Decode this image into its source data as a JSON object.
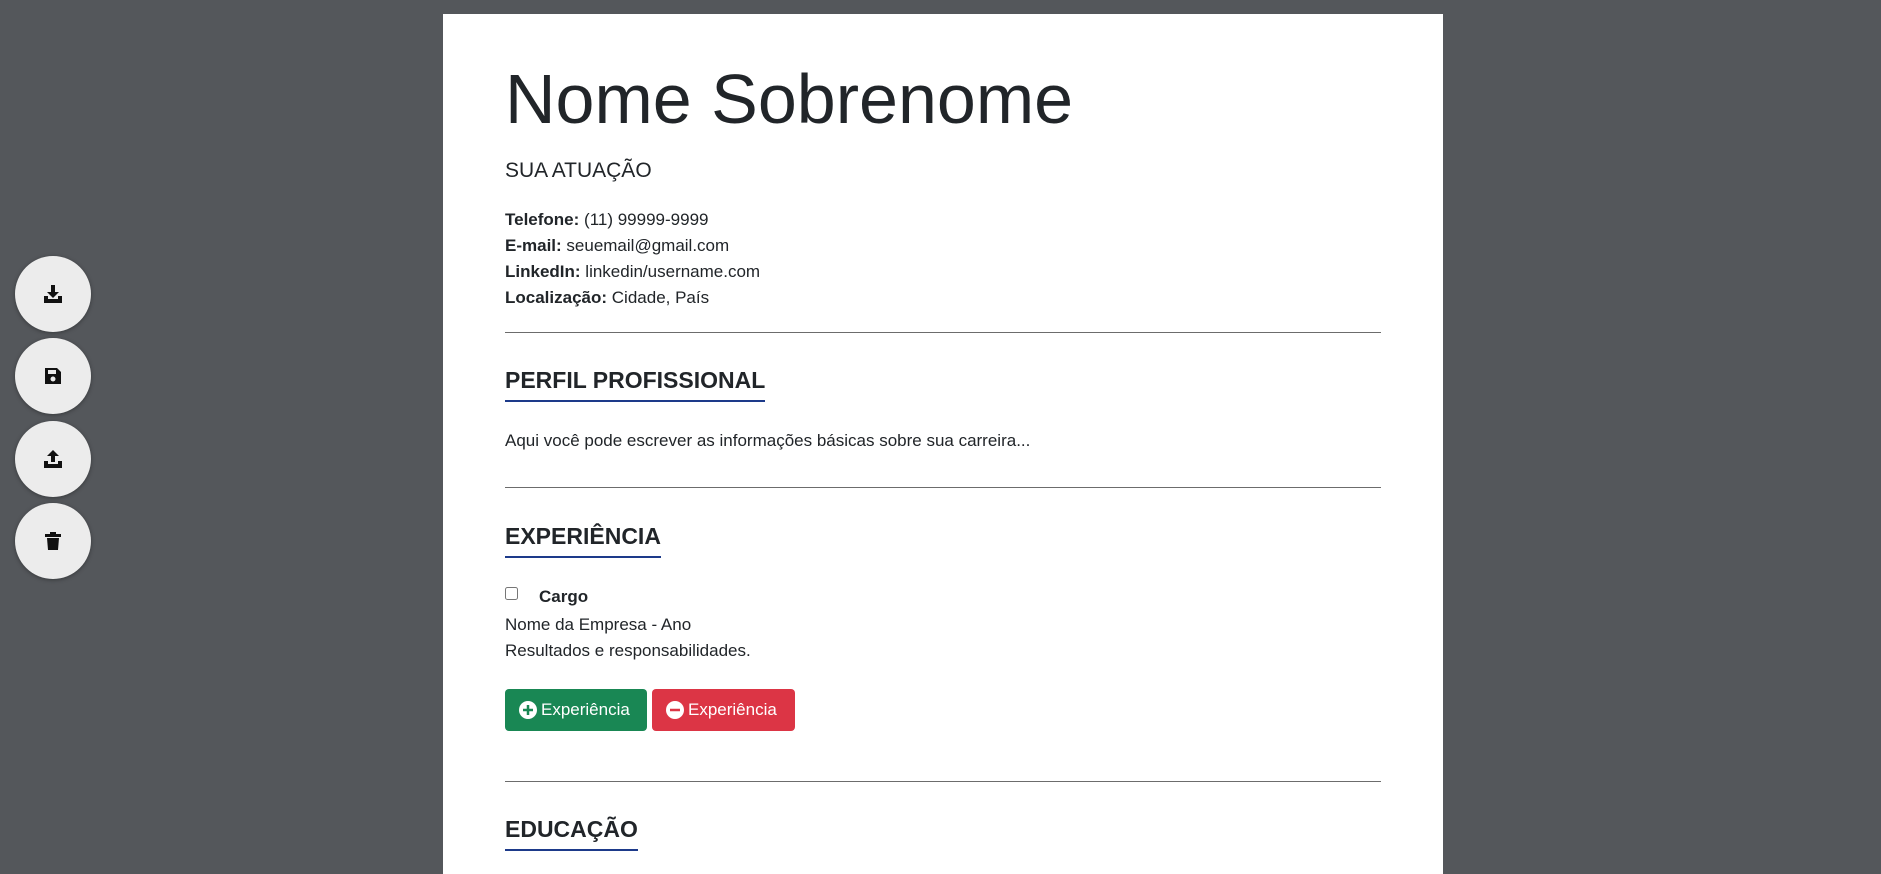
{
  "toolbar": {
    "download_icon": "download-icon",
    "save_icon": "floppy-disk-icon",
    "upload_icon": "upload-icon",
    "delete_icon": "trash-icon"
  },
  "resume": {
    "name": "Nome Sobrenome",
    "role": "SUA ATUAÇÃO",
    "contact": {
      "phone_label": "Telefone:",
      "phone_value": " (11) 99999-9999",
      "email_label": "E-mail:",
      "email_value": " seuemail@gmail.com",
      "linkedin_label": "LinkedIn:",
      "linkedin_value": " linkedin/username.com",
      "location_label": "Localização:",
      "location_value": " Cidade, País"
    },
    "profile": {
      "title": "PERFIL PROFISSIONAL",
      "text": "Aqui você pode escrever as informações básicas sobre sua carreira..."
    },
    "experience": {
      "title": "EXPERIÊNCIA",
      "items": [
        {
          "position": "Cargo",
          "company_year": "Nome da Empresa - Ano",
          "description": "Resultados e responsabilidades.",
          "checked": false
        }
      ],
      "add_label": "Experiência",
      "remove_label": "Experiência"
    },
    "education": {
      "title": "EDUCAÇÃO"
    }
  },
  "colors": {
    "background": "#54575b",
    "add_button": "#198754",
    "remove_button": "#dc3545",
    "section_underline": "#1d3a8a"
  }
}
